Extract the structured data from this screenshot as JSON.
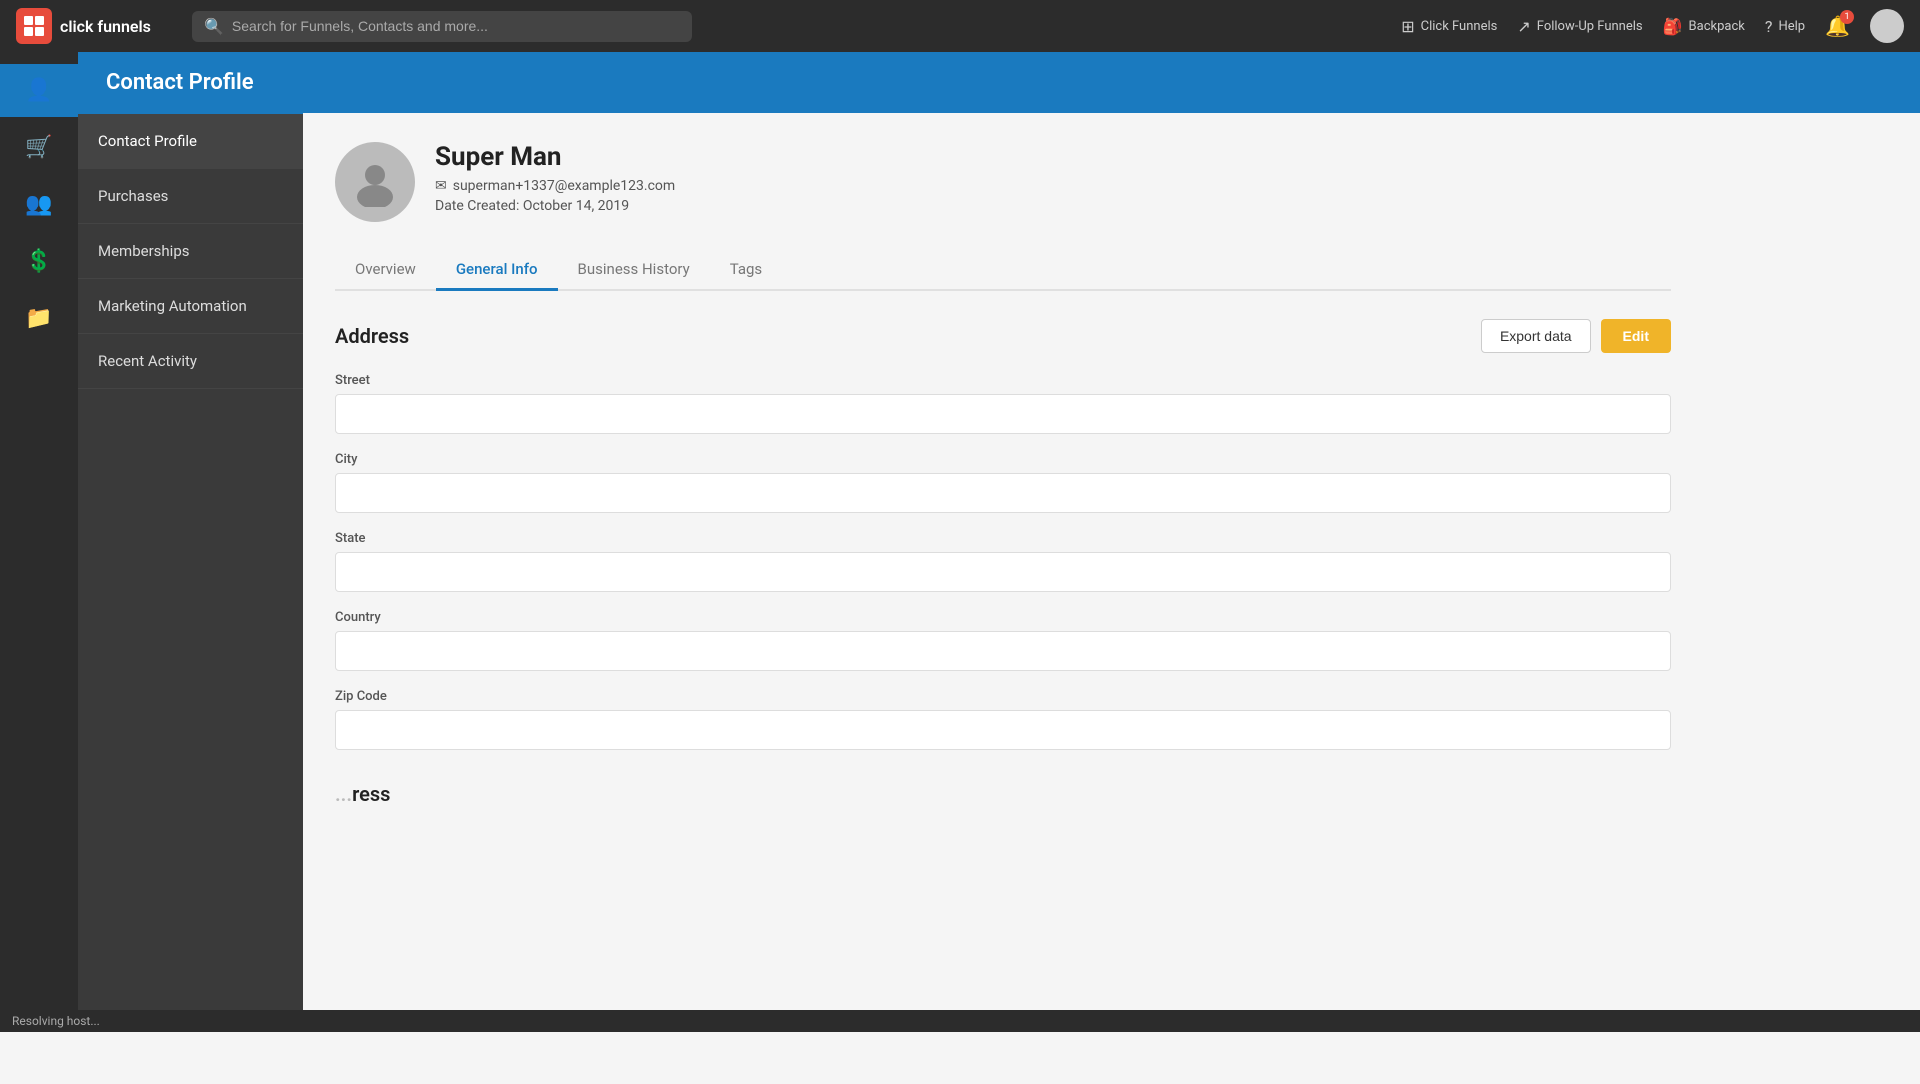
{
  "app": {
    "logo_text": "click funnels",
    "logo_icon": "X"
  },
  "topnav": {
    "search_placeholder": "Search for Funnels, Contacts and more...",
    "items": [
      {
        "id": "click-funnels",
        "label": "Click Funnels",
        "icon": "⊞"
      },
      {
        "id": "follow-up-funnels",
        "label": "Follow-Up Funnels",
        "icon": "↗"
      },
      {
        "id": "backpack",
        "label": "Backpack",
        "icon": "🎒"
      },
      {
        "id": "help",
        "label": "Help",
        "icon": "?"
      }
    ],
    "notification_count": "1"
  },
  "icon_sidebar": {
    "items": [
      {
        "id": "contacts",
        "icon": "👤",
        "active": true
      },
      {
        "id": "purchases",
        "icon": "🛒",
        "active": false
      },
      {
        "id": "memberships",
        "icon": "👥",
        "active": false
      },
      {
        "id": "marketing",
        "icon": "💰",
        "active": false
      },
      {
        "id": "activity",
        "icon": "📁",
        "active": false
      }
    ]
  },
  "text_sidebar": {
    "items": [
      {
        "id": "contact-profile",
        "label": "Contact Profile",
        "active": true
      },
      {
        "id": "purchases",
        "label": "Purchases",
        "active": false
      },
      {
        "id": "memberships",
        "label": "Memberships",
        "active": false
      },
      {
        "id": "marketing-automation",
        "label": "Marketing Automation",
        "active": false
      },
      {
        "id": "recent-activity",
        "label": "Recent Activity",
        "active": false
      }
    ]
  },
  "header": {
    "title": "Contact Profile"
  },
  "profile": {
    "name": "Super Man",
    "email": "superman+1337@example123.com",
    "date_created_label": "Date Created:",
    "date_created": "October 14, 2019"
  },
  "tabs": [
    {
      "id": "overview",
      "label": "Overview",
      "active": false
    },
    {
      "id": "general-info",
      "label": "General Info",
      "active": true
    },
    {
      "id": "business-history",
      "label": "Business History",
      "active": false
    },
    {
      "id": "tags",
      "label": "Tags",
      "active": false
    }
  ],
  "address_section": {
    "title": "Address",
    "export_btn": "Export data",
    "edit_btn": "Edit",
    "fields": [
      {
        "id": "street",
        "label": "Street",
        "value": ""
      },
      {
        "id": "city",
        "label": "City",
        "value": ""
      },
      {
        "id": "state",
        "label": "State",
        "value": ""
      },
      {
        "id": "country",
        "label": "Country",
        "value": ""
      },
      {
        "id": "zip-code",
        "label": "Zip Code",
        "value": ""
      }
    ]
  },
  "bottom_section_title": "ress",
  "status_bar": {
    "text": "Resolving host..."
  }
}
